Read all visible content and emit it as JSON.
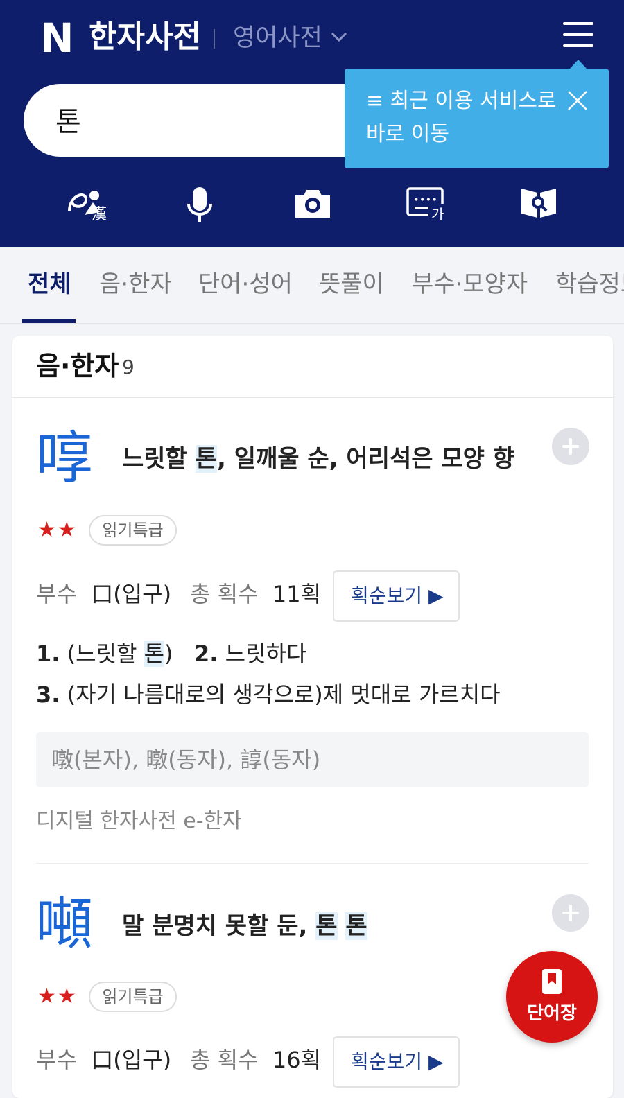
{
  "header": {
    "logo": "N",
    "title": "한자사전",
    "sub_title": "영어사전",
    "menu_icon": "hamburger-icon"
  },
  "search": {
    "value": "톤"
  },
  "tooltip": {
    "line1": "≡ 최근 이용 서비스로",
    "line2": "바로 이동"
  },
  "tools": [
    {
      "icon": "handwriting-hanja-icon"
    },
    {
      "icon": "microphone-icon"
    },
    {
      "icon": "camera-icon"
    },
    {
      "icon": "keyboard-icon"
    },
    {
      "icon": "book-search-icon"
    }
  ],
  "tabs": [
    "전체",
    "음·한자",
    "단어·성어",
    "뜻풀이",
    "부수·모양자",
    "학습정보"
  ],
  "section": {
    "title": "음·한자",
    "count": "9"
  },
  "entries": [
    {
      "hanja": "啍",
      "meaning_pre": "느릿할 ",
      "meaning_hl": "톤",
      "meaning_post": ", 일깨울 순, 어리석은 모양 향",
      "stars": "★★",
      "badge": "읽기특급",
      "radical_label": "부수",
      "radical_value": "口(입구)",
      "strokes_label": "총 획수",
      "strokes_value": "11획",
      "stroke_btn": "획순보기 ▶",
      "def1_num": "1.",
      "def1_pre": " (느릿할 ",
      "def1_hl": "톤",
      "def1_post": ")",
      "def2_num": "2.",
      "def2_text": " 느릿하다",
      "def3_num": "3.",
      "def3_text": " (자기 나름대로의 생각으로)제 멋대로 가르치다",
      "variants": "噋(본자), 暾(동자), 諄(동자)",
      "source": "디지털 한자사전 e-한자"
    },
    {
      "hanja": "噸",
      "meaning_pre": "말 분명치 못할 둔, ",
      "meaning_hl": "톤",
      "meaning_mid": " ",
      "meaning_hl2": "톤",
      "stars": "★★",
      "badge": "읽기특급",
      "radical_label": "부수",
      "radical_value": "口(입구)",
      "strokes_label": "총 획수",
      "strokes_value": "16획",
      "stroke_btn": "획순보기 ▶"
    }
  ],
  "fab": {
    "label": "단어장",
    "icon": "bookmark-icon"
  },
  "colors": {
    "header_bg": "#0f1e6b",
    "tooltip_bg": "#42aee8",
    "hanja": "#1a66d6",
    "fab_bg": "#d61414"
  }
}
